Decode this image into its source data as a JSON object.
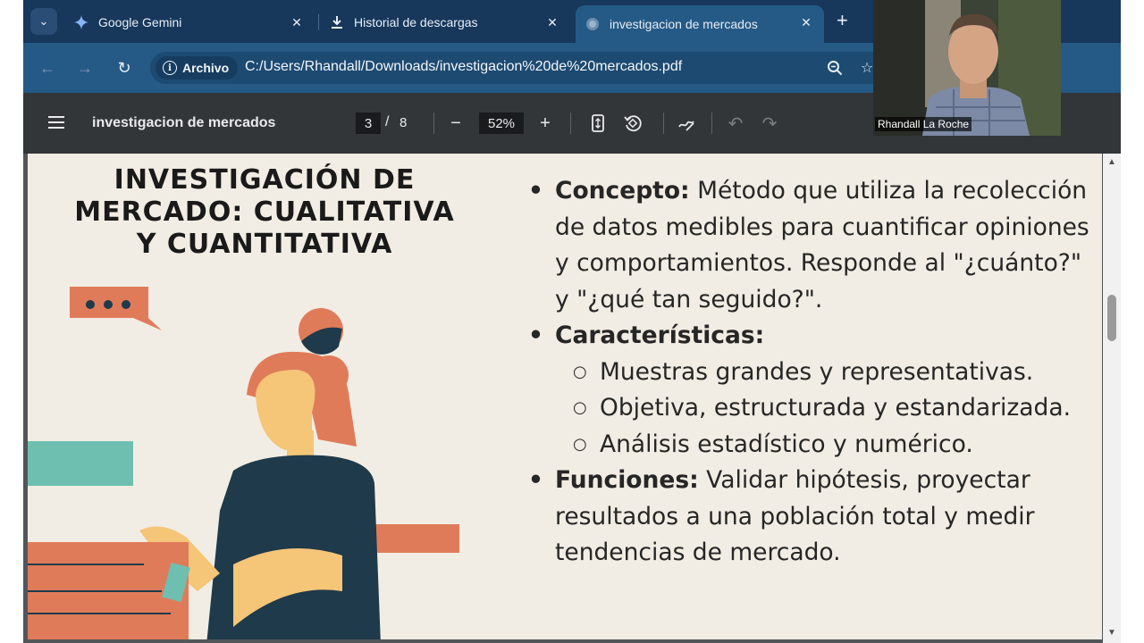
{
  "tabs": [
    {
      "label": "Google Gemini",
      "icon": "gemini-icon",
      "active": false
    },
    {
      "label": "Historial de descargas",
      "icon": "download-icon",
      "active": false
    },
    {
      "label": "investigacion de mercados",
      "icon": "pdf-globe-icon",
      "active": true
    }
  ],
  "address": {
    "site_chip": "Archivo",
    "url": "C:/Users/Rhandall/Downloads/investigacion%20de%20mercados.pdf"
  },
  "pdf": {
    "title": "investigacion de mercados",
    "page": "3",
    "page_sep": "/",
    "total": "8",
    "zoom": "52%"
  },
  "slide": {
    "title_lines": [
      "INVESTIGACIÓN DE",
      "MERCADO: CUALITATIVA",
      "Y CUANTITATIVA"
    ],
    "concepto_label": "Concepto:",
    "concepto_text": " Método que utiliza la recolección de datos medibles para cuantificar opiniones y comportamientos. Responde al \"¿cuánto?\" y \"¿qué tan seguido?\".",
    "caracteristicas_label": "Características:",
    "caracteristicas_items": [
      "Muestras grandes y representativas.",
      "Objetiva, estructurada y estandarizada.",
      "Análisis estadístico y numérico."
    ],
    "funciones_label": "Funciones:",
    "funciones_text": " Validar hipótesis, proyectar resultados a una población total y medir tendencias de mercado."
  },
  "webcam": {
    "name": "Rhandall La Roche"
  },
  "colors": {
    "tabstrip": "#17375b",
    "toolbar": "#255a86",
    "pdfbar": "#323639",
    "slide_bg": "#f2ede4",
    "coral": "#e07b5a",
    "teal": "#6fbfb0",
    "navy": "#1f3a4a",
    "skin": "#f5c578"
  }
}
